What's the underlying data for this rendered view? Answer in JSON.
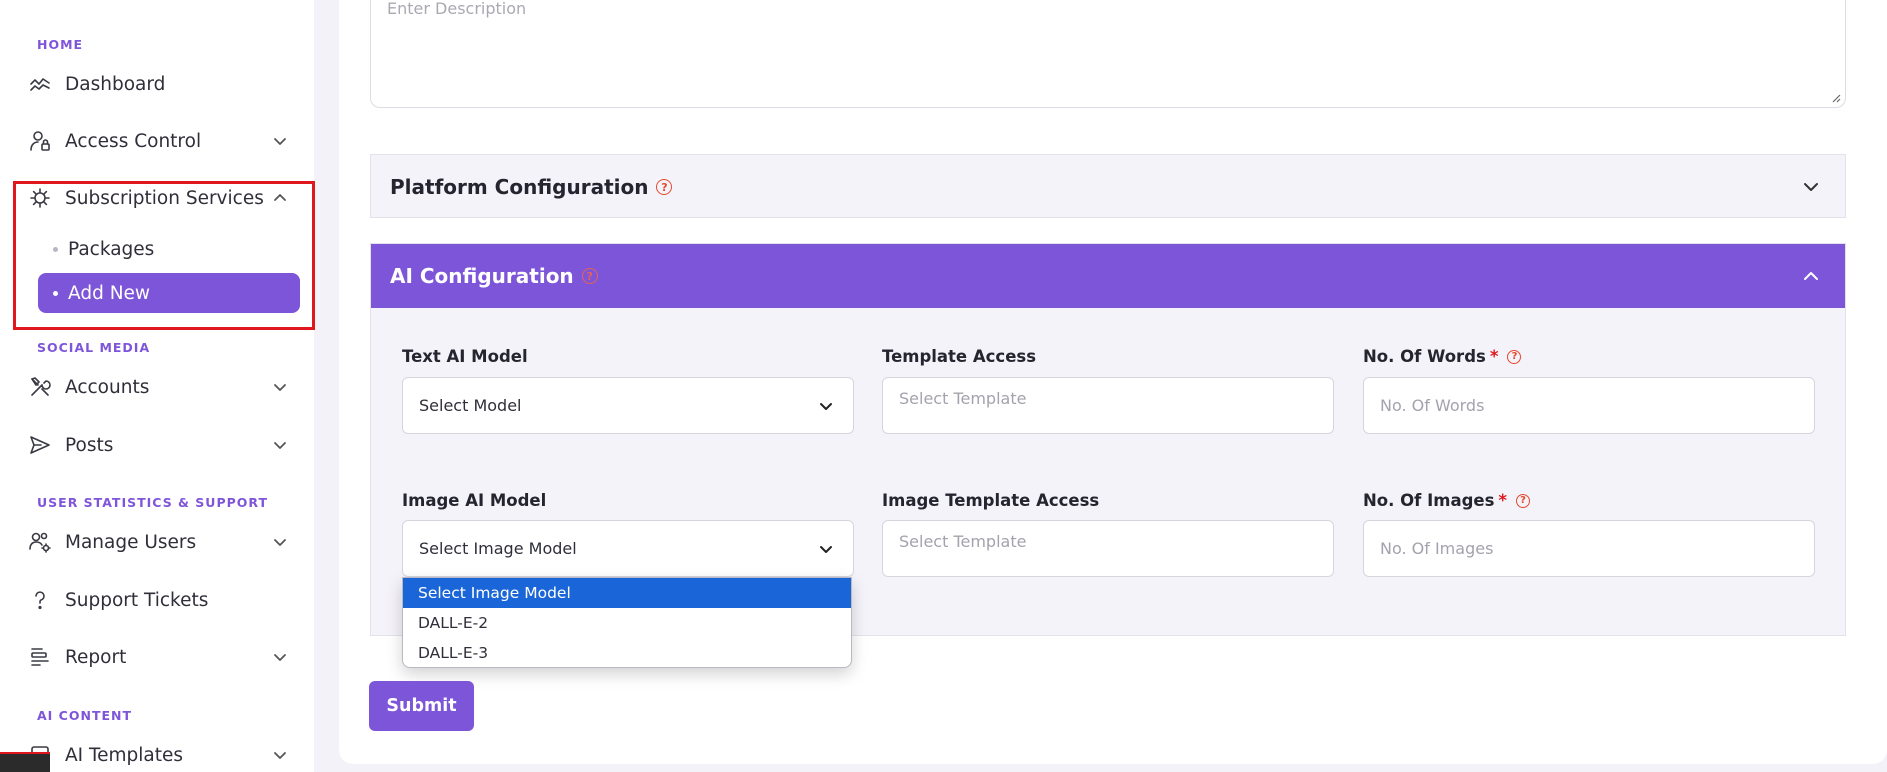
{
  "sidebar": {
    "sections": {
      "home": "HOME",
      "social_media": "SOCIAL MEDIA",
      "user_stats": "USER STATISTICS & SUPPORT",
      "ai_content": "AI CONTENT"
    },
    "items": {
      "dashboard": "Dashboard",
      "access_control": "Access Control",
      "subscription_services": "Subscription Services",
      "packages": "Packages",
      "add_new": "Add New",
      "accounts": "Accounts",
      "posts": "Posts",
      "manage_users": "Manage Users",
      "support_tickets": "Support Tickets",
      "report": "Report",
      "ai_templates": "AI Templates"
    }
  },
  "form": {
    "description_placeholder": "Enter Description",
    "platform_config_title": "Platform Configuration",
    "ai_config_title": "AI Configuration",
    "help_glyph": "?",
    "required_mark": "*",
    "text_ai_model": {
      "label": "Text AI Model",
      "value": "Select Model"
    },
    "template_access": {
      "label": "Template Access",
      "placeholder": "Select Template"
    },
    "no_of_words": {
      "label": "No. Of Words",
      "placeholder": "No. Of Words"
    },
    "image_ai_model": {
      "label": "Image AI Model",
      "value": "Select Image Model"
    },
    "image_template_access": {
      "label": "Image Template Access",
      "placeholder": "Select Template"
    },
    "no_of_images": {
      "label": "No. Of Images",
      "placeholder": "No. Of Images"
    },
    "image_model_options": [
      "Select Image Model",
      "DALL-E-2",
      "DALL-E-3"
    ],
    "submit_label": "Submit"
  },
  "colors": {
    "accent": "#7d55d8",
    "highlight": "#e0181e",
    "dropdown_selected": "#1a66d9"
  }
}
